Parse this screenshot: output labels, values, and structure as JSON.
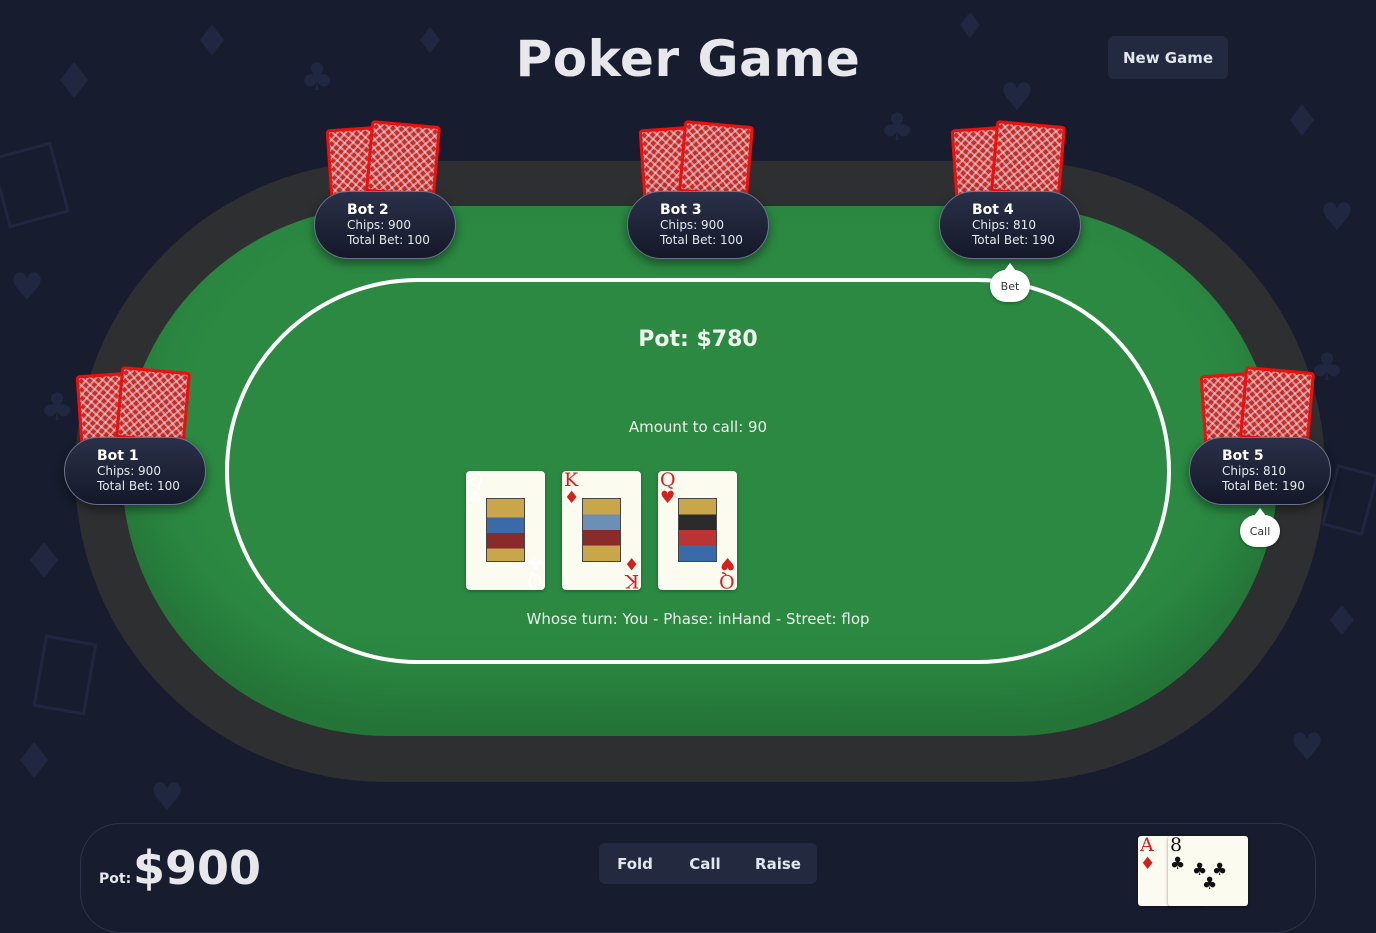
{
  "title": "Poker Game",
  "new_game_label": "New Game",
  "table": {
    "pot_label": "Pot: $780",
    "amount_to_call": "Amount to call: 90",
    "status": "Whose turn: You - Phase: inHand - Street: flop",
    "community_cards": [
      {
        "rank": "Q",
        "suit": "♣",
        "color": "black"
      },
      {
        "rank": "K",
        "suit": "♦",
        "color": "red"
      },
      {
        "rank": "Q",
        "suit": "♥",
        "color": "red"
      }
    ]
  },
  "bots": [
    {
      "name": "Bot 1",
      "chips": "Chips: 900",
      "total_bet": "Total Bet: 100",
      "action": ""
    },
    {
      "name": "Bot 2",
      "chips": "Chips: 900",
      "total_bet": "Total Bet: 100",
      "action": ""
    },
    {
      "name": "Bot 3",
      "chips": "Chips: 900",
      "total_bet": "Total Bet: 100",
      "action": ""
    },
    {
      "name": "Bot 4",
      "chips": "Chips: 810",
      "total_bet": "Total Bet: 190",
      "action": "Bet"
    },
    {
      "name": "Bot 5",
      "chips": "Chips: 810",
      "total_bet": "Total Bet: 190",
      "action": "Call"
    }
  ],
  "player": {
    "pot_label": "Pot:",
    "pot_value": "$900",
    "actions": {
      "fold": "Fold",
      "call": "Call",
      "raise": "Raise"
    },
    "hole_cards": [
      {
        "rank": "A",
        "suit": "♦",
        "color": "red"
      },
      {
        "rank": "8",
        "suit": "♣",
        "color": "black"
      }
    ]
  },
  "colors": {
    "background": "#171c2e",
    "felt": "#2b8942",
    "rail": "#2e2f31",
    "card_back": "#c22d2d",
    "button": "#232a40"
  }
}
